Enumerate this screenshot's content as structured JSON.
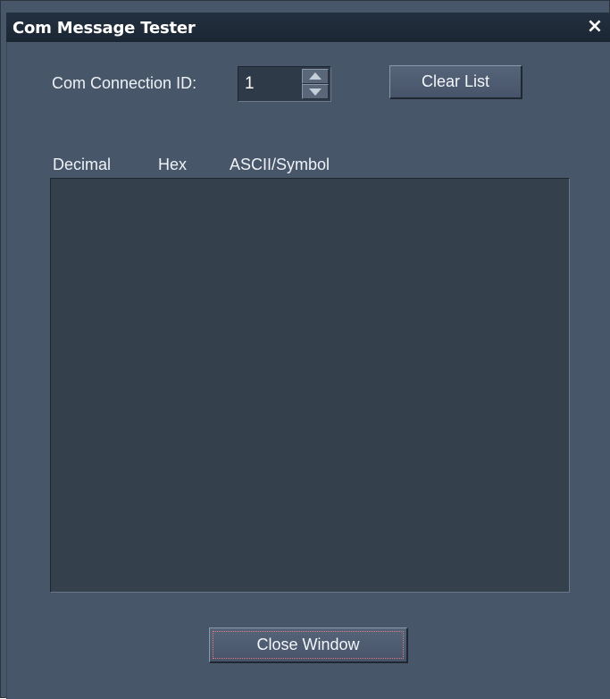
{
  "window": {
    "title": "Com Message Tester",
    "close_glyph": "×"
  },
  "connection": {
    "label": "Com Connection ID:",
    "value": "1"
  },
  "toolbar": {
    "clear_label": "Clear List"
  },
  "list": {
    "columns": [
      "Decimal",
      "Hex",
      "ASCII/Symbol"
    ],
    "rows": []
  },
  "footer": {
    "close_label": "Close Window"
  },
  "colors": {
    "window_bg": "#48566a",
    "titlebar_bg": "#1b2633",
    "listbox_bg": "#35404d",
    "focus_ring": "#e07a80"
  },
  "icons": {
    "close": "close-icon",
    "spin_up": "arrow-up-icon",
    "spin_down": "arrow-down-icon"
  }
}
